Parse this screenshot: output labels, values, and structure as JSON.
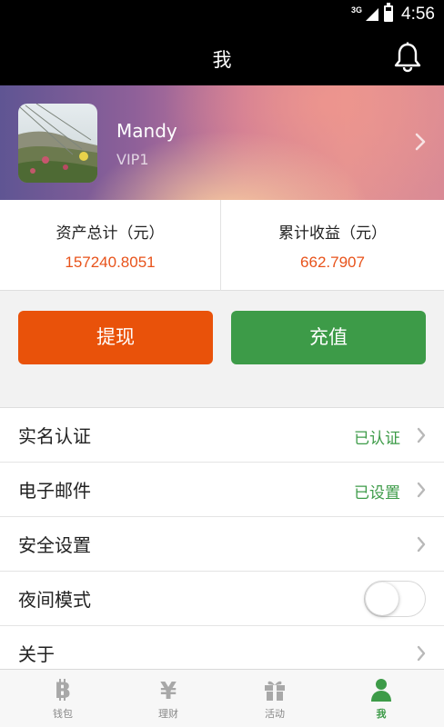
{
  "status_bar": {
    "network": "3G",
    "time": "4:56"
  },
  "app_bar": {
    "title": "我",
    "icon": "bell-icon"
  },
  "profile": {
    "name": "Mandy",
    "level": "VIP1"
  },
  "stats": {
    "total_assets_label": "资产总计（元）",
    "total_assets_value": "157240.8051",
    "cumulative_earnings_label": "累计收益（元）",
    "cumulative_earnings_value": "662.7907"
  },
  "actions": {
    "withdraw_label": "提现",
    "recharge_label": "充值"
  },
  "menu": {
    "real_name": {
      "label": "实名认证",
      "status": "已认证"
    },
    "email": {
      "label": "电子邮件",
      "status": "已设置"
    },
    "security": {
      "label": "安全设置"
    },
    "night_mode": {
      "label": "夜间模式",
      "enabled": false
    },
    "about": {
      "label": "关于"
    }
  },
  "tabs": [
    {
      "label": "钱包",
      "icon": "bitcoin-icon",
      "active": false
    },
    {
      "label": "理财",
      "icon": "yen-icon",
      "active": false
    },
    {
      "label": "活动",
      "icon": "gift-icon",
      "active": false
    },
    {
      "label": "我",
      "icon": "user-icon",
      "active": true
    }
  ],
  "colors": {
    "accent_orange": "#e9520a",
    "accent_green": "#3d9b48",
    "value_orange": "#e8531b",
    "app_bar": "#000000"
  }
}
